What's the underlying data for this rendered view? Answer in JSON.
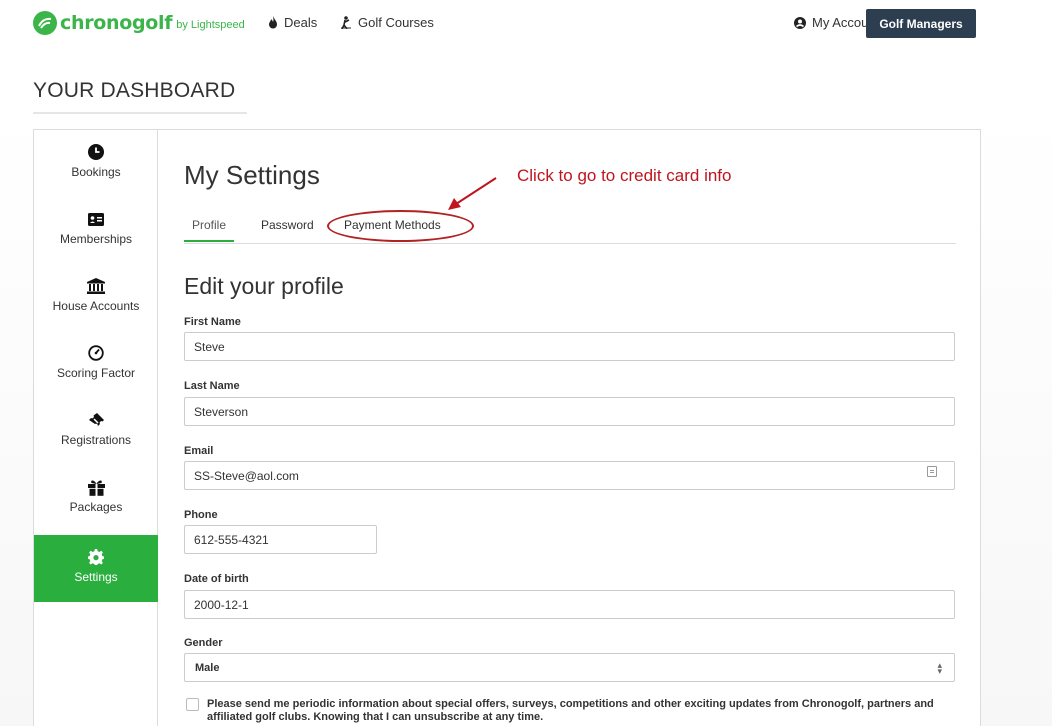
{
  "brand": {
    "name": "chronogolf",
    "by": "by Lightspeed"
  },
  "nav": {
    "deals": "Deals",
    "golf_courses": "Golf Courses",
    "my_account": "My Account",
    "golf_managers": "Golf Managers"
  },
  "dashboard": {
    "title": "YOUR DASHBOARD"
  },
  "sidebar": {
    "items": [
      {
        "label": "Bookings",
        "icon": "clock-icon"
      },
      {
        "label": "Memberships",
        "icon": "id-card-icon"
      },
      {
        "label": "House Accounts",
        "icon": "bank-icon"
      },
      {
        "label": "Scoring Factor",
        "icon": "gauge-icon"
      },
      {
        "label": "Registrations",
        "icon": "ticket-icon"
      },
      {
        "label": "Packages",
        "icon": "gift-icon"
      },
      {
        "label": "Settings",
        "icon": "gear-icon",
        "active": true
      }
    ]
  },
  "settings": {
    "title": "My Settings",
    "tabs": {
      "profile": "Profile",
      "password": "Password",
      "payment": "Payment Methods"
    },
    "annotation": "Click to go to credit card info"
  },
  "profile": {
    "title": "Edit your profile",
    "first_name_label": "First Name",
    "first_name": "Steve",
    "last_name_label": "Last Name",
    "last_name": "Steverson",
    "email_label": "Email",
    "email": "SS-Steve@aol.com",
    "phone_label": "Phone",
    "phone": "612-555-4321",
    "dob_label": "Date of birth",
    "dob": "2000-12-1",
    "gender_label": "Gender",
    "gender": "Male",
    "newsletter_text": "Please send me periodic information about special offers, surveys, competitions and other exciting updates from Chronogolf, partners and affiliated golf clubs. Knowing that I can unsubscribe at any time."
  },
  "colors": {
    "brand_green": "#3bb54a",
    "active_green": "#2aaf3f",
    "dark_button": "#2c3e50",
    "annotation_red": "#c0151c"
  }
}
